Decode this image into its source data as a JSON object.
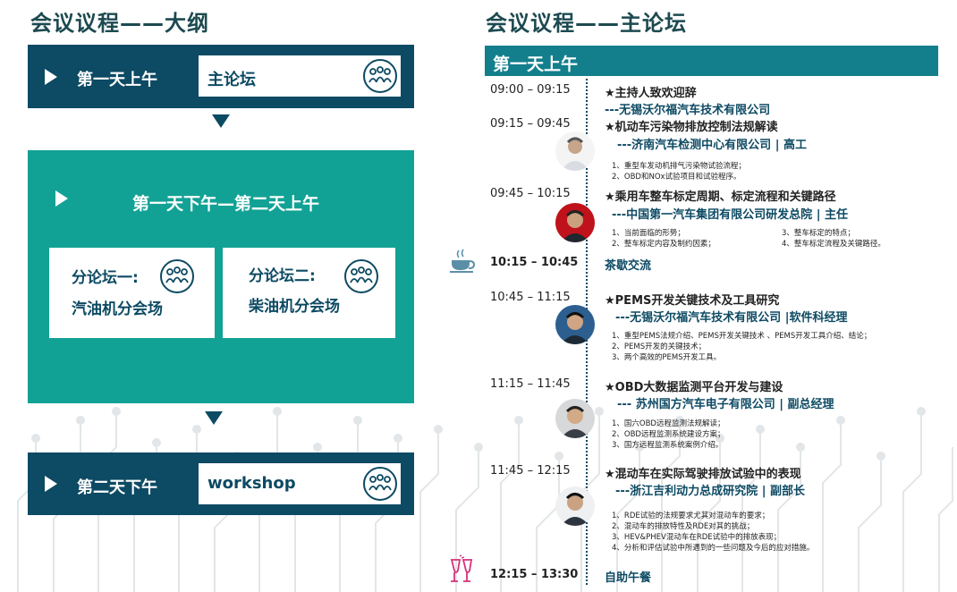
{
  "left": {
    "title": "会议议程——大纲",
    "day1_am": {
      "label": "第一天上午",
      "box": "主论坛"
    },
    "day1_pm": {
      "label": "第一天下午—第二天上午",
      "forum1": {
        "line1": "分论坛一:",
        "line2": "汽油机分会场"
      },
      "forum2": {
        "line1": "分论坛二:",
        "line2": "柴油机分会场"
      }
    },
    "day2_pm": {
      "label": "第二天下午",
      "box": "workshop"
    }
  },
  "right": {
    "title": "会议议程——主论坛",
    "day_label": "第一天上午",
    "sessions": [
      {
        "time": "09:00 – 09:15",
        "title": "★主持人致欢迎辞",
        "org": "---无锡沃尔福汽车技术有限公司"
      },
      {
        "time": "09:15 – 09:45",
        "title": "★机动车污染物排放控制法规解读",
        "org": "---济南汽车检测中心有限公司 | 高工",
        "notes": [
          "1、重型车发动机排气污染物试验流程；",
          "2、OBD和NOx试验项目和试验程序。"
        ]
      },
      {
        "time": "09:45 – 10:15",
        "title": "★乘用车整车标定周期、标定流程和关键路径",
        "org": "---中国第一汽车集团有限公司研发总院 | 主任",
        "notes_left": [
          "1、当前面临的形势；",
          "2、整车标定内容及制约因素；"
        ],
        "notes_right": [
          "3、整车标定的特点；",
          "4、整车标定流程及关键路径。"
        ]
      },
      {
        "time": "10:15 – 10:45",
        "title": "茶歇交流"
      },
      {
        "time": "10:45 – 11:15",
        "title": "★PEMS开发关键技术及工具研究",
        "org": "---无锡沃尔福汽车技术有限公司 |软件科经理",
        "notes": [
          "1、重型PEMS法规介绍、PEMS开发关键技术 、PEMS开发工具介绍、结论；",
          "2、PEMS开发的关键技术；",
          "3、两个高效的PEMS开发工具。"
        ]
      },
      {
        "time": "11:15 – 11:45",
        "title": "★OBD大数据监测平台开发与建设",
        "org": "--- 苏州国方汽车电子有限公司 | 副总经理",
        "notes": [
          "1、国六OBD远程监测法规解读；",
          "2、OBD远程监测系统建设方案；",
          "3、国方远程监测系统案例介绍。"
        ]
      },
      {
        "time": "11:45 – 12:15",
        "title": "★混动车在实际驾驶排放试验中的表现",
        "org": "---浙江吉利动力总成研究院 | 副部长",
        "notes": [
          "1、RDE试验的法规要求尤其对混动车的要求；",
          "2、混动车的排放特性及RDE对其的挑战；",
          "3、HEV&PHEV混动车在RDE试验中的排放表现；",
          "4、分析和评估试验中所遇到的一些问题及今后的应对措施。"
        ]
      },
      {
        "time": "12:15 – 13:30",
        "title": "自助午餐"
      }
    ]
  },
  "icons": {
    "people": "people-group-icon",
    "tea": "tea-cup-icon",
    "toast": "champagne-glasses-icon"
  },
  "colors": {
    "dark": "#0d4a63",
    "teal": "#12a295",
    "bar": "#137f8c"
  }
}
